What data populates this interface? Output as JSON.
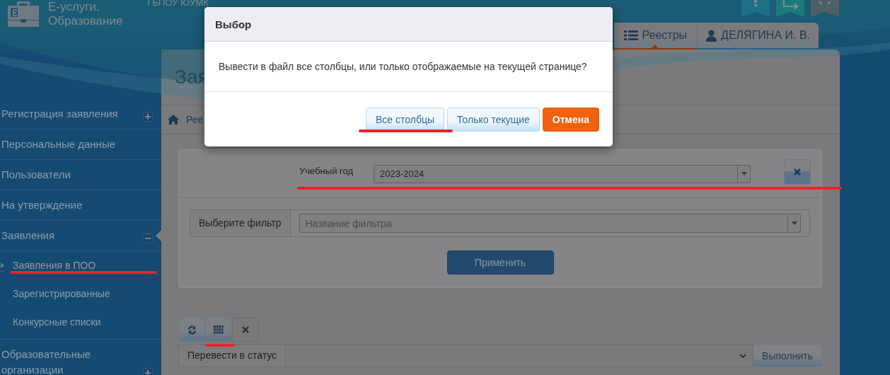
{
  "header": {
    "org": "ГБПОУ ЮУМК",
    "app_title": [
      "Е-услуги.",
      "Образование"
    ]
  },
  "nav_tabs": [
    {
      "label": "Реестры",
      "kind": "list",
      "selected": true
    },
    {
      "label": "ДЕЛЯГИНА И. В.",
      "kind": "user",
      "selected": false
    }
  ],
  "sidebar": {
    "items": [
      {
        "label": "Регистрация заявления",
        "expanded": false
      },
      {
        "label": "Персональные данные"
      },
      {
        "label": "Пользователи"
      },
      {
        "label": "На утверждение"
      },
      {
        "label": "Заявления",
        "expanded": true,
        "children": [
          {
            "label": "Заявления в ПОО",
            "selected": true
          },
          {
            "label": "Зарегистрированные",
            "selected": false
          },
          {
            "label": "Конкурсные списки",
            "selected": false
          }
        ]
      },
      {
        "label": "Образовательные организации",
        "expanded": false
      }
    ]
  },
  "page": {
    "heading": "Зая",
    "breadcrumb": "Рее"
  },
  "filters": {
    "year_label": "Учебный год",
    "year_value": "2023-2024",
    "filter_label": "Выберите фильтр",
    "filter_placeholder": "Название фильтра",
    "apply_button": "Применить"
  },
  "toolbar": [
    {
      "kind": "refresh"
    },
    {
      "kind": "columns"
    },
    {
      "kind": "clear"
    }
  ],
  "status_action": {
    "label": "Перевести в статус",
    "button": "Выполнить"
  },
  "dialog": {
    "title": "Выбор",
    "message": "Вывести в файл все столбцы, или только отображаемые на текущей странице?",
    "buttons": [
      {
        "label": "Все столбцы",
        "kind": "secondary"
      },
      {
        "label": "Только текущие",
        "kind": "secondary"
      },
      {
        "label": "Отмена",
        "kind": "danger"
      }
    ]
  }
}
